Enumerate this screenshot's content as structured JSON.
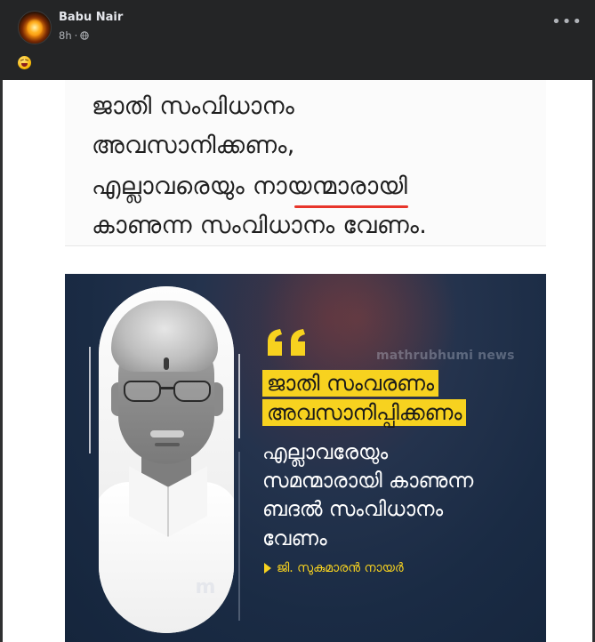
{
  "post": {
    "author_name": "Babu Nair",
    "time": "8h",
    "separator": "·",
    "more_label": "•••",
    "caption_emoji": "😝"
  },
  "image_text": {
    "lines": [
      "ജാതി സംവിധാനം",
      "അവസാനിക്കണം,",
      "എല്ലാവരെയും നായന്മാരായി",
      "കാണുന്ന സംവിധാനം വേണം."
    ]
  },
  "news_card": {
    "watermark": "mathrubhumi news",
    "logo": "m",
    "highlight_lines": [
      "ജാതി സംവരണം",
      "അവസാനിപ്പിക്കണം"
    ],
    "body_lines": [
      "എല്ലാവരേയും",
      "സമന്മാരായി കാണുന്ന",
      "ബദൽ സംവിധാനം",
      "വേണം"
    ],
    "attribution": "ജി. സുകുമാരൻ നായർ"
  },
  "colors": {
    "header_bg": "#242526",
    "card_bg": "#1a2b44",
    "highlight": "#f7d21f",
    "underline": "#e8362b"
  }
}
